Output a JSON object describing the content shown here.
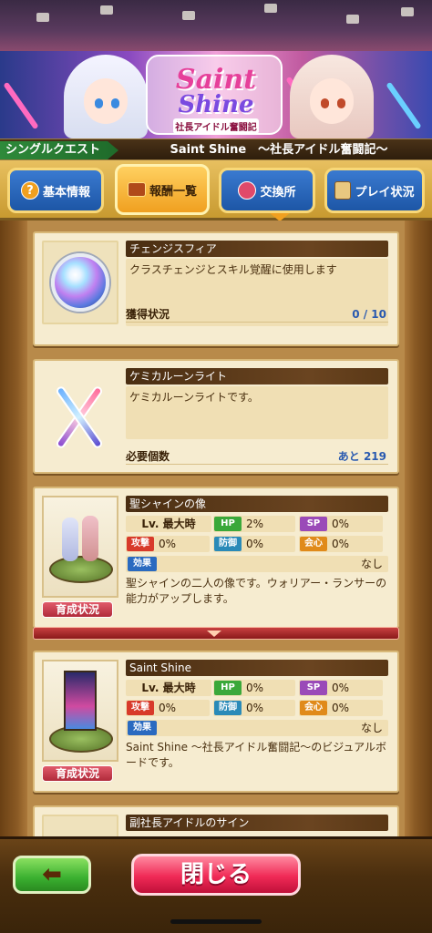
{
  "header": {
    "logo_line1": "Saint",
    "logo_line2": "Shine",
    "logo_sub": "社長アイドル奮闘記"
  },
  "quest": {
    "label": "シングルクエスト",
    "title": "Saint Shine　〜社長アイドル奮闘記〜"
  },
  "tabs": [
    {
      "label": "基本情報",
      "icon": "question-icon",
      "active": false
    },
    {
      "label": "報酬一覧",
      "icon": "treasure-chest-icon",
      "active": true
    },
    {
      "label": "交換所",
      "icon": "exchange-bag-icon",
      "active": false
    },
    {
      "label": "プレイ状況",
      "icon": "scroll-icon",
      "active": false
    }
  ],
  "items": [
    {
      "name": "チェンジスフィア",
      "desc": "クラスチェンジとスキル覚醒に使用します",
      "foot_label": "獲得状況",
      "foot_value": "0 / 10",
      "icon": "change-sphere-orb-icon"
    },
    {
      "name": "ケミカルーンライト",
      "desc": "ケミカルーンライトです。",
      "foot_label": "必要個数",
      "foot_value": "あと 219",
      "icon": "crossed-glowsticks-icon"
    }
  ],
  "statues": [
    {
      "name": "聖シャインの像",
      "lv": "Lv. 最大時",
      "hp_label": "HP",
      "hp": "2%",
      "sp_label": "SP",
      "sp": "0%",
      "atk_label": "攻撃",
      "atk": "0%",
      "def_label": "防御",
      "def": "0%",
      "crit_label": "会心",
      "crit": "0%",
      "effect_label": "効果",
      "effect": "なし",
      "desc": "聖シャインの二人の像です。ウォリアー・ランサーの能力がアップします。",
      "grow_label": "育成状況"
    },
    {
      "name": "Saint Shine",
      "lv": "Lv. 最大時",
      "hp_label": "HP",
      "hp": "0%",
      "sp_label": "SP",
      "sp": "0%",
      "atk_label": "攻撃",
      "atk": "0%",
      "def_label": "防御",
      "def": "0%",
      "crit_label": "会心",
      "crit": "0%",
      "effect_label": "効果",
      "effect": "なし",
      "desc": "Saint Shine 〜社長アイドル奮闘記〜のビジュアルボードです。",
      "grow_label": "育成状況"
    }
  ],
  "partial_item": {
    "name": "副社長アイドルのサイン"
  },
  "footer": {
    "back_icon": "left-arrow-icon",
    "close_label": "閉じる"
  },
  "colors": {
    "hp": "#3aa83a",
    "sp": "#9a4ab8",
    "atk": "#d83a2a",
    "def": "#2a8ab8",
    "crit": "#e08a1a",
    "accent": "#f02a56"
  }
}
